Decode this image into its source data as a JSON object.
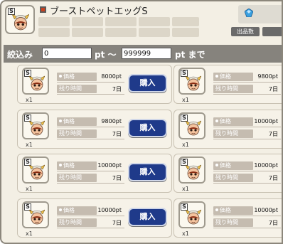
{
  "header": {
    "title": "ブーストペットエッグS",
    "s_badge": "S",
    "listing_count_button": "出品数",
    "gem_icon": "blue-gem-icon",
    "colors": {
      "title_dot": "#c8401e",
      "buy_button": "#1f3a8a",
      "filter_bar": "#86837d"
    }
  },
  "filter": {
    "label": "絞込み",
    "min_value": "0",
    "range_sep": "pt ～",
    "max_value": "999999",
    "until": "pt まで"
  },
  "listings_left": [
    {
      "price_label": "価格",
      "price": "8000pt",
      "time_label": "残り時間",
      "time": "7日",
      "buy_label": "購入",
      "qty": "x1",
      "badge": "S"
    },
    {
      "price_label": "価格",
      "price": "9800pt",
      "time_label": "残り時間",
      "time": "7日",
      "buy_label": "購入",
      "qty": "x1",
      "badge": "S"
    },
    {
      "price_label": "価格",
      "price": "10000pt",
      "time_label": "残り時間",
      "time": "7日",
      "buy_label": "購入",
      "qty": "x1",
      "badge": "S"
    },
    {
      "price_label": "価格",
      "price": "10000pt",
      "time_label": "残り時間",
      "time": "7日",
      "buy_label": "購入",
      "qty": "x1",
      "badge": "S"
    }
  ],
  "listings_right": [
    {
      "price_label": "価格",
      "price": "9800pt",
      "time_label": "残り時間",
      "time": "7日",
      "qty": "x1",
      "badge": "S"
    },
    {
      "price_label": "価格",
      "price": "10000pt",
      "time_label": "残り時間",
      "time": "7日",
      "qty": "x1",
      "badge": "S"
    },
    {
      "price_label": "価格",
      "price": "10000pt",
      "time_label": "残り時間",
      "time": "7日",
      "qty": "x1",
      "badge": "S"
    },
    {
      "price_label": "価格",
      "price": "10000pt",
      "time_label": "残り時間",
      "time": "7日",
      "qty": "x1",
      "badge": "S"
    }
  ]
}
